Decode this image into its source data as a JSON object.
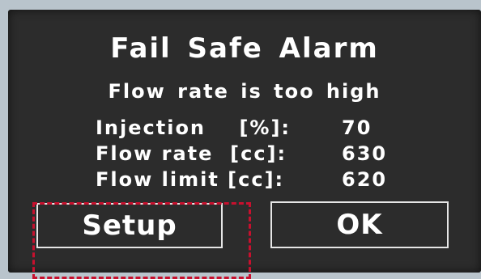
{
  "alarm": {
    "title": "Fail Safe Alarm",
    "message": "Flow rate is too high"
  },
  "readings": [
    {
      "label": "Injection    [%]:",
      "value": "70"
    },
    {
      "label": "Flow rate  [cc]:",
      "value": "630"
    },
    {
      "label": "Flow limit [cc]:",
      "value": "620"
    }
  ],
  "buttons": {
    "setup_label": "Setup",
    "ok_label": "OK"
  },
  "colors": {
    "screen_background": "#2c2c2c",
    "text": "#ffffff",
    "highlight": "#c8102e"
  }
}
